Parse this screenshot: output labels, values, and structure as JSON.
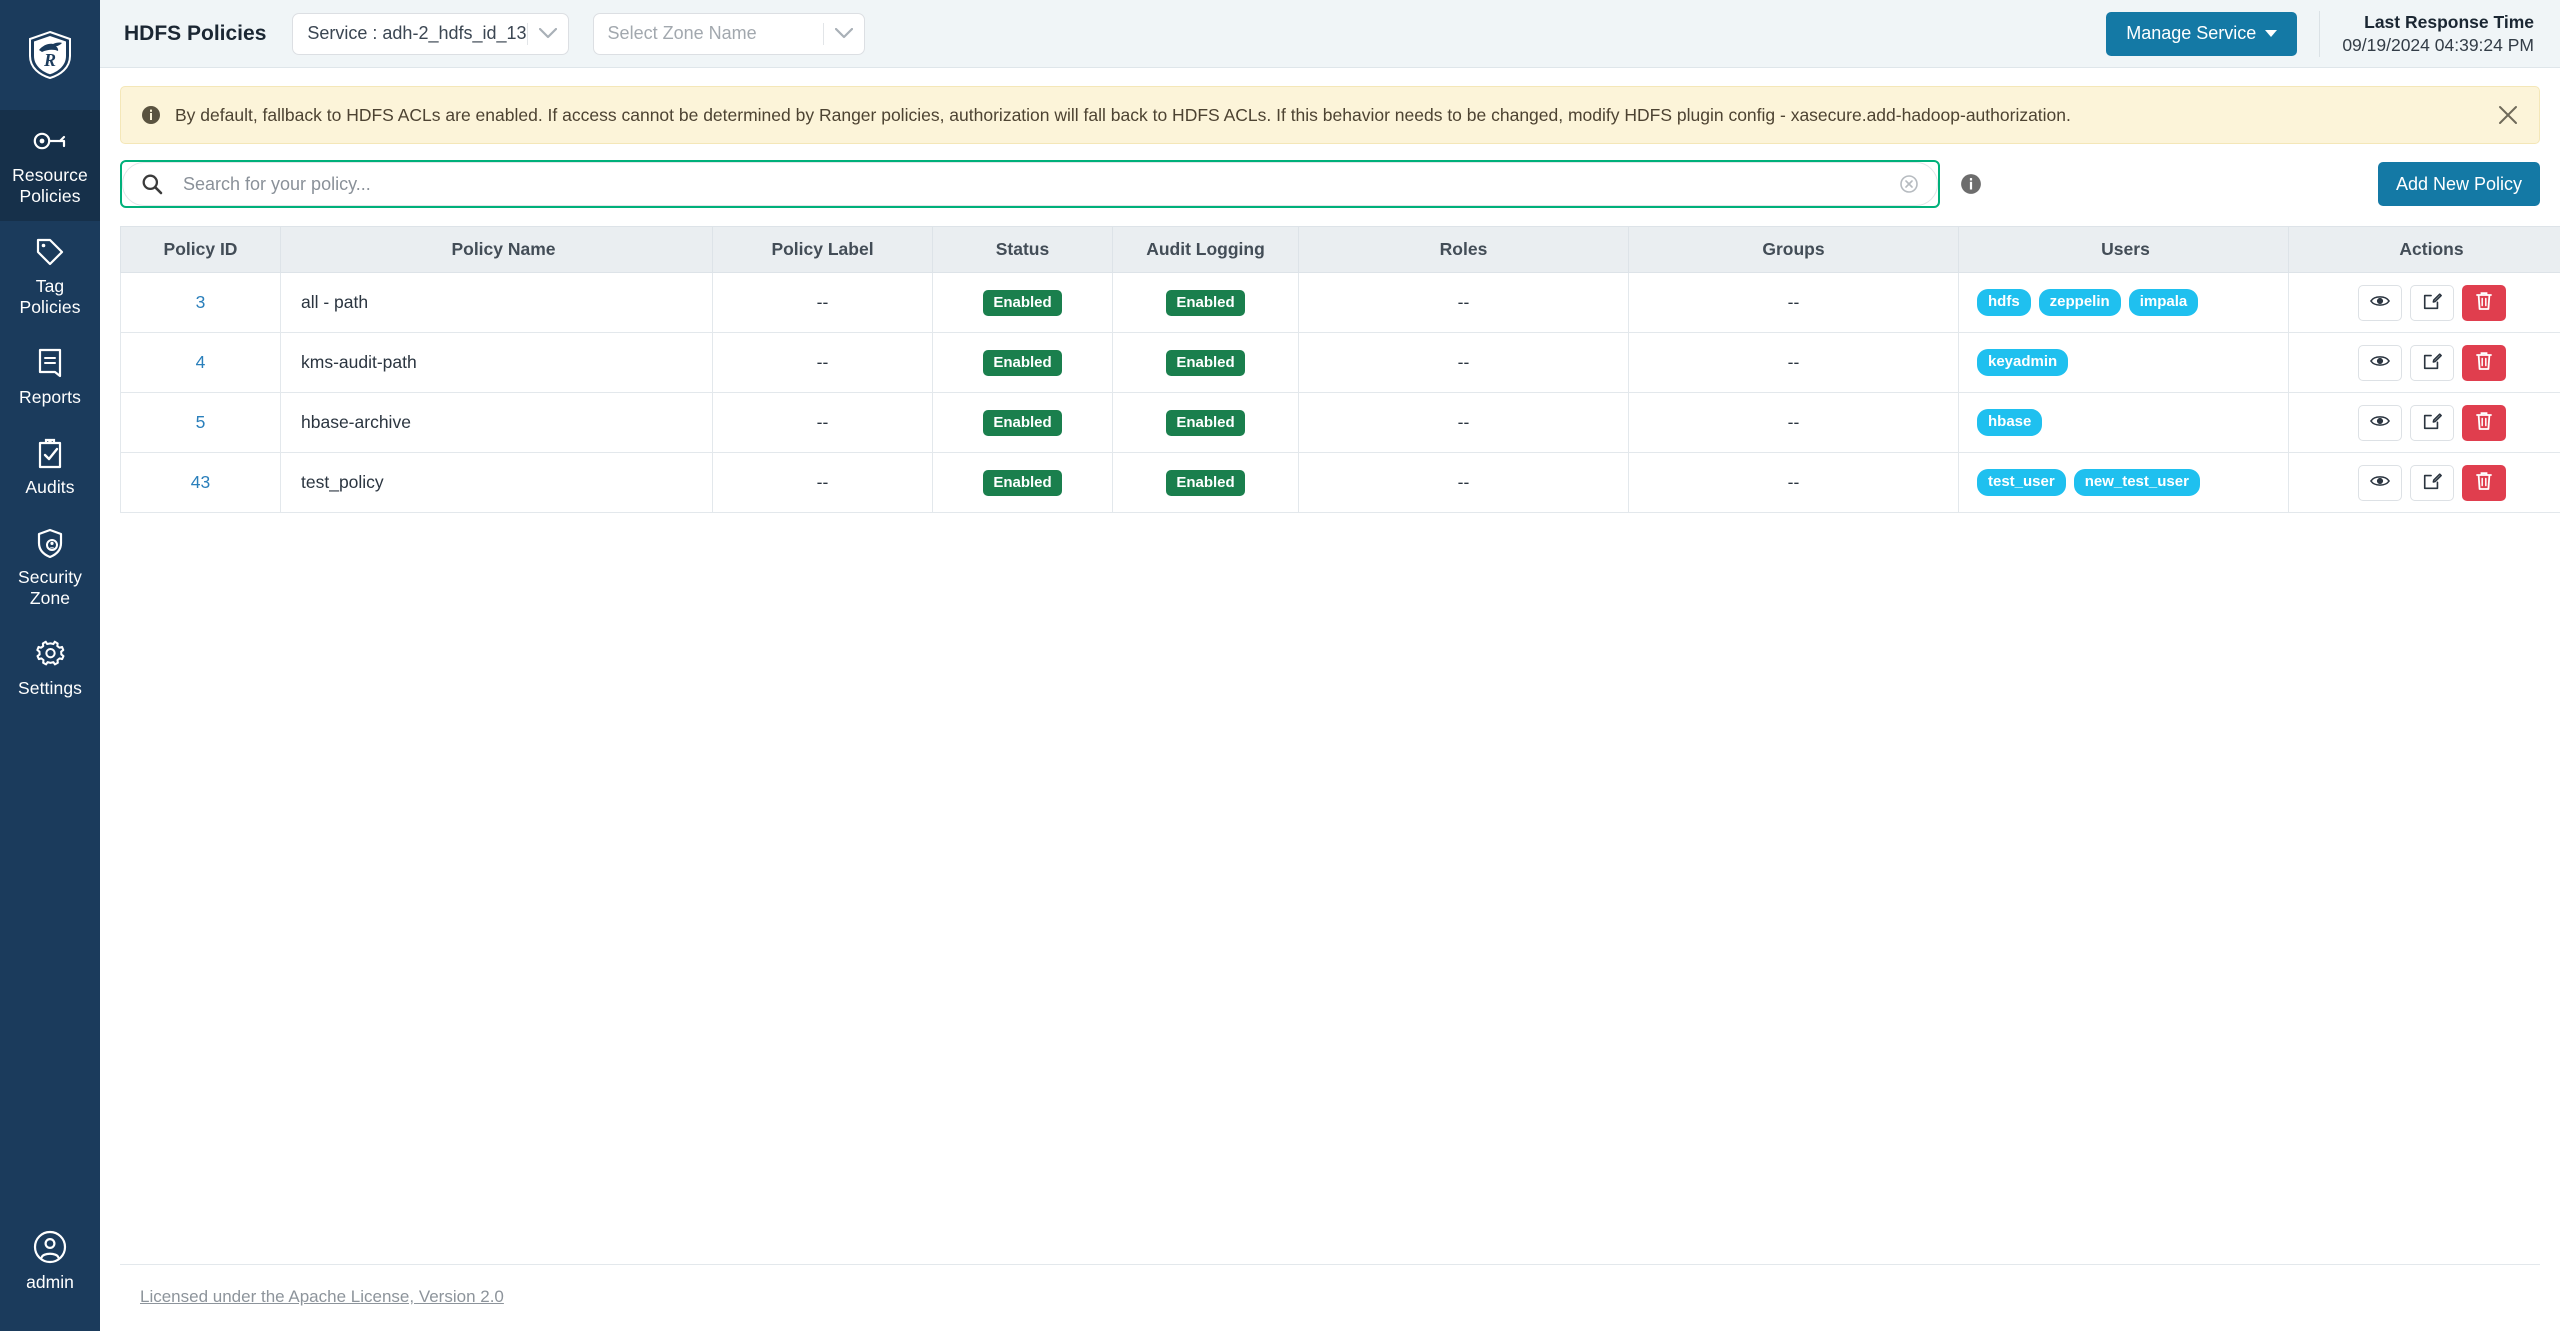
{
  "sidebar": {
    "logo_name": "ranger-shield-logo",
    "items": [
      {
        "label": "Resource\nPolicies",
        "line1": "Resource",
        "line2": "Policies",
        "icon": "key-icon",
        "active": true
      },
      {
        "label": "Tag Policies",
        "line1": "Tag",
        "line2": "Policies",
        "icon": "tag-icon",
        "active": false
      },
      {
        "label": "Reports",
        "line1": "Reports",
        "line2": "",
        "icon": "report-icon",
        "active": false
      },
      {
        "label": "Audits",
        "line1": "Audits",
        "line2": "",
        "icon": "clipboard-check-icon",
        "active": false
      },
      {
        "label": "Security Zone",
        "line1": "Security",
        "line2": "Zone",
        "icon": "shield-user-icon",
        "active": false
      },
      {
        "label": "Settings",
        "line1": "Settings",
        "line2": "",
        "icon": "gear-icon",
        "active": false
      }
    ],
    "user": {
      "name": "admin",
      "icon": "user-circle-icon"
    }
  },
  "topbar": {
    "page_title": "HDFS Policies",
    "service_select": {
      "value": "Service : adh-2_hdfs_id_13",
      "caret": "chevron-down-icon"
    },
    "zone_select": {
      "placeholder": "Select Zone Name",
      "caret": "chevron-down-icon"
    },
    "manage_service_button": "Manage Service",
    "last_response_title": "Last Response Time",
    "last_response_time": "09/19/2024 04:39:24 PM",
    "accent_color": "#1479a5"
  },
  "alert": {
    "icon": "info-circle-icon",
    "message": "By default, fallback to HDFS ACLs are enabled. If access cannot be determined by Ranger policies, authorization will fall back to HDFS ACLs. If this behavior needs to be changed, modify HDFS plugin config - xasecure.add-hadoop-authorization.",
    "close_icon": "close-icon",
    "bg_color": "#fcf4d9"
  },
  "search": {
    "placeholder": "Search for your policy...",
    "value": "",
    "icon": "search-icon",
    "clear_icon": "clear-circle-icon",
    "info_icon": "info-circle-icon",
    "focus_color": "#00b07a"
  },
  "actions": {
    "add_new_policy": "Add New Policy"
  },
  "table": {
    "columns": [
      "Policy ID",
      "Policy Name",
      "Policy Label",
      "Status",
      "Audit Logging",
      "Roles",
      "Groups",
      "Users",
      "Actions"
    ],
    "rows": [
      {
        "policy_id": "3",
        "policy_name": "all - path",
        "policy_label": "--",
        "status": "Enabled",
        "audit_logging": "Enabled",
        "roles": "--",
        "groups": "--",
        "users": [
          "hdfs",
          "zeppelin",
          "impala"
        ]
      },
      {
        "policy_id": "4",
        "policy_name": "kms-audit-path",
        "policy_label": "--",
        "status": "Enabled",
        "audit_logging": "Enabled",
        "roles": "--",
        "groups": "--",
        "users": [
          "keyadmin"
        ]
      },
      {
        "policy_id": "5",
        "policy_name": "hbase-archive",
        "policy_label": "--",
        "status": "Enabled",
        "audit_logging": "Enabled",
        "roles": "--",
        "groups": "--",
        "users": [
          "hbase"
        ]
      },
      {
        "policy_id": "43",
        "policy_name": "test_policy",
        "policy_label": "--",
        "status": "Enabled",
        "audit_logging": "Enabled",
        "roles": "--",
        "groups": "--",
        "users": [
          "test_user",
          "new_test_user"
        ]
      }
    ],
    "row_actions": {
      "view": "eye-icon",
      "edit": "edit-icon",
      "delete": "trash-icon"
    },
    "status_color": "#1a7f4d",
    "chip_color": "#1fc0ef",
    "delete_color": "#e03e4e"
  },
  "footer": {
    "license_text": "Licensed under the Apache License, Version 2.0"
  }
}
